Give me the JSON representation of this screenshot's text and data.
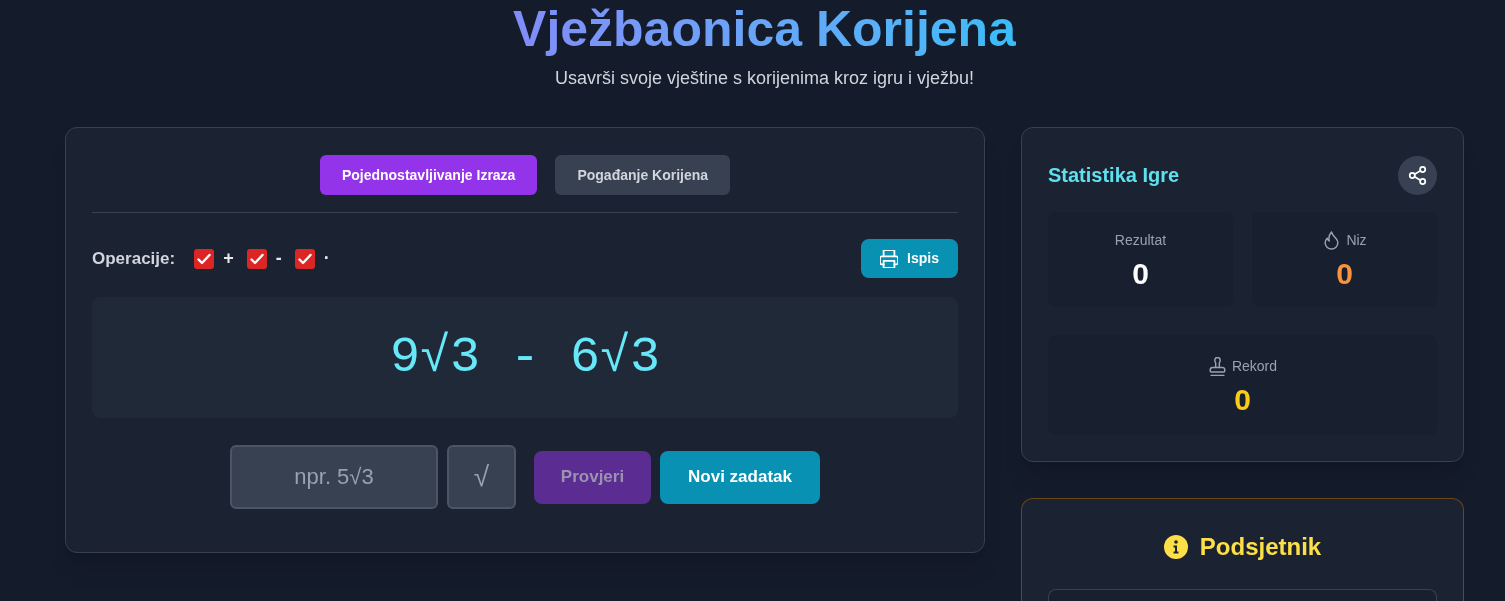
{
  "header": {
    "title": "Vježbaonica Korijena",
    "subtitle": "Usavrši svoje vještine s korijenima kroz igru i vježbu!"
  },
  "practice": {
    "tabs": [
      {
        "label": "Pojednostavljivanje Izraza",
        "selected": true
      },
      {
        "label": "Pogađanje Korijena",
        "selected": false
      }
    ],
    "operations_label": "Operacije:",
    "operations": [
      {
        "label": "+",
        "checked": true
      },
      {
        "label": "-",
        "checked": true
      },
      {
        "label": "·",
        "checked": true
      }
    ],
    "print_button": "Ispis",
    "expression": "9√3 - 6√3",
    "answer_field": {
      "placeholder": "npr. 5√3"
    },
    "root_button": "√",
    "check_button": {
      "label": "Provjeri",
      "disabled": true
    },
    "new_task_button": "Novi zadatak"
  },
  "statistics": {
    "title": "Statistika Igre",
    "stats": [
      {
        "kind": "score",
        "label": "Rezultat",
        "value": "0"
      },
      {
        "kind": "streak",
        "label": "Niz",
        "value": "0"
      },
      {
        "kind": "record",
        "label": "Rekord",
        "value": "0"
      }
    ]
  },
  "reminder": {
    "title": "Podsjetnik"
  }
}
